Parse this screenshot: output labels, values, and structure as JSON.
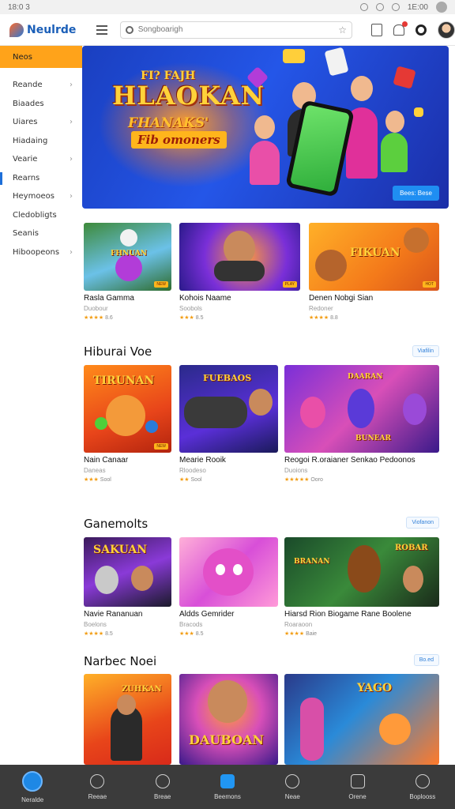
{
  "status": {
    "time": "18:0 3",
    "right": "1E:00"
  },
  "header": {
    "logo": "Neulrde",
    "search_placeholder": "Songboarigh"
  },
  "sidebar": {
    "items": [
      {
        "label": "Neos"
      },
      {
        "label": "Reande"
      },
      {
        "label": "Biaades"
      },
      {
        "label": "Uiares"
      },
      {
        "label": "Hiadaing"
      },
      {
        "label": "Vearie"
      },
      {
        "label": "Rearns"
      },
      {
        "label": "Heymoeos"
      },
      {
        "label": "Cledobligts"
      },
      {
        "label": "Seanis"
      },
      {
        "label": "Hiboopeons"
      }
    ]
  },
  "hero": {
    "title_top": "FI? FAJH",
    "title_main": "HLAOKAN",
    "title_sub": "FHANAKS'",
    "title_tag": "Fib omoners",
    "cta": "Bees: Bese"
  },
  "rows": [
    {
      "title": "",
      "cards": [
        {
          "name": "Rasla Gamma",
          "sub": "Duobour",
          "rating": "★★★★",
          "rating_label": "8.6"
        },
        {
          "name": "Kohois Naame",
          "sub": "Soobols",
          "rating": "★★★",
          "rating_label": "8.5"
        },
        {
          "name": "Denen Nobgi Sian",
          "sub": "Redoner",
          "rating": "★★★★",
          "rating_label": "8.8"
        }
      ]
    },
    {
      "title": "Hiburai Voe",
      "view_all": "Viafilin",
      "cards": [
        {
          "name": "Nain Canaar",
          "sub": "Daneas",
          "rating": "★★★",
          "rating_label": "Sool"
        },
        {
          "name": "Mearie Rooik",
          "sub": "Rloodeso",
          "rating": "★★",
          "rating_label": "Sool"
        },
        {
          "name": "Reogoi R.oraianer Senkao Pedoonos",
          "sub": "Duoions",
          "rating": "★★★★★",
          "rating_label": "Ooro"
        }
      ]
    },
    {
      "title": "Ganemolts",
      "view_all": "Viofanon",
      "cards": [
        {
          "name": "Navie Rananuan",
          "sub": "Boelons",
          "rating": "★★★★",
          "rating_label": "8.5"
        },
        {
          "name": "Aldds Gemrider",
          "sub": "Bracods",
          "rating": "★★★",
          "rating_label": "8.5"
        },
        {
          "name": "Hiarsd Rion Biogame Rane Boolene",
          "sub": "Roaraoon",
          "rating": "★★★★",
          "rating_label": "Baie"
        }
      ]
    },
    {
      "title": "Narbec Noei",
      "view_all": "Bo.ed",
      "cards": [
        {
          "name": "",
          "sub": "",
          "rating": "",
          "rating_label": ""
        },
        {
          "name": "",
          "sub": "",
          "rating": "",
          "rating_label": ""
        },
        {
          "name": "",
          "sub": "",
          "rating": "",
          "rating_label": ""
        }
      ]
    }
  ],
  "bottom_nav": [
    {
      "label": "Neralde",
      "icon": "home-icon"
    },
    {
      "label": "Reeae",
      "icon": "search-icon"
    },
    {
      "label": "Breae",
      "icon": "heart-icon"
    },
    {
      "label": "Beemons",
      "icon": "store-icon"
    },
    {
      "label": "Neae",
      "icon": "star-icon"
    },
    {
      "label": "Orene",
      "icon": "page-icon"
    },
    {
      "label": "Boplooss",
      "icon": "profile-icon"
    }
  ]
}
